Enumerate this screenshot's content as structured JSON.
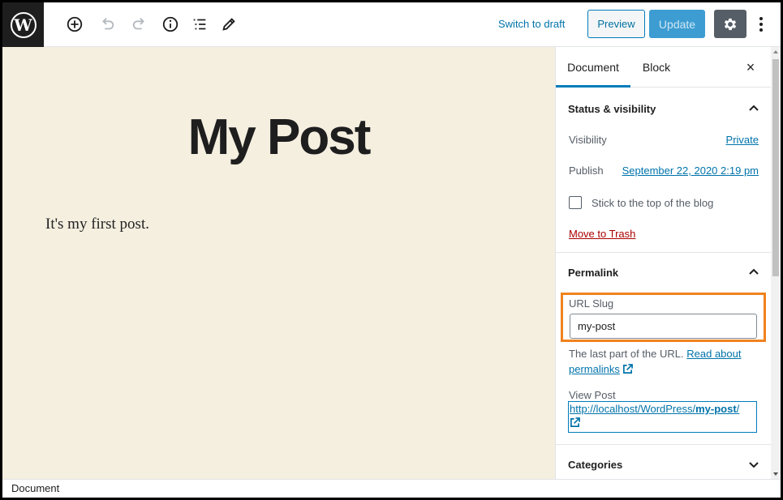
{
  "app": {
    "logo_letter": "W"
  },
  "toolbar": {
    "tools": [
      {
        "name": "add-block-icon"
      },
      {
        "name": "undo-icon"
      },
      {
        "name": "redo-icon"
      },
      {
        "name": "info-icon"
      },
      {
        "name": "list-view-icon"
      },
      {
        "name": "edit-icon"
      }
    ],
    "switch_to_draft": "Switch to draft",
    "preview": "Preview",
    "update": "Update",
    "settings_icon": "gear-icon",
    "more_icon": "vertical-ellipsis-icon"
  },
  "post": {
    "title": "My Post",
    "body": "It's my first post."
  },
  "sidebar": {
    "tabs": [
      "Document",
      "Block"
    ],
    "close": "×",
    "status_panel": {
      "title": "Status & visibility",
      "visibility_label": "Visibility",
      "visibility_value": "Private",
      "publish_label": "Publish",
      "publish_value": "September 22, 2020 2:19 pm",
      "sticky_label": "Stick to the top of the blog",
      "sticky_checked": false,
      "trash": "Move to Trash"
    },
    "permalink_panel": {
      "title": "Permalink",
      "slug_label": "URL Slug",
      "slug_value": "my-post",
      "help_text": "The last part of the URL.",
      "help_link_1": "Read about",
      "help_link_2": "permalinks",
      "view_post_label": "View Post",
      "view_post_prefix": "http://localhost/WordPress/",
      "view_post_slug": "my-post",
      "view_post_suffix": "/"
    },
    "categories_panel": {
      "title": "Categories"
    }
  },
  "footer": {
    "breadcrumb": "Document"
  },
  "colors": {
    "accent": "#007cba",
    "canvas_bg": "#f5efe0",
    "highlight": "#f0821e",
    "trash": "#aa0000"
  }
}
